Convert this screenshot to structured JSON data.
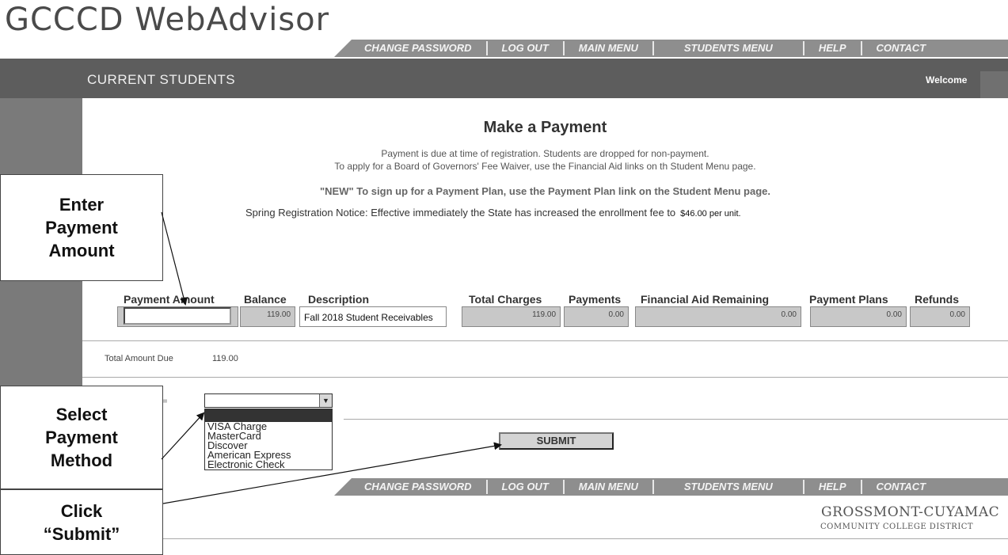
{
  "app": {
    "logo": "GCCCD WebAdvisor"
  },
  "nav": {
    "change_password": "CHANGE PASSWORD",
    "log_out": "LOG OUT",
    "main_menu": "MAIN MENU",
    "students_menu": "STUDENTS MENU",
    "help": "HELP",
    "contact": "CONTACT"
  },
  "header": {
    "section": "CURRENT STUDENTS",
    "welcome": "Welcome"
  },
  "page": {
    "title": "Make a Payment",
    "notice_line1": "Payment is due at time of registration. Students are dropped for non-payment.",
    "notice_line2": "To apply for a Board of Governors' Fee Waiver, use the Financial Aid links on th Student Menu page.",
    "notice_new": "\"NEW\" To sign up for a Payment Plan, use the Payment Plan link on the Student Menu page.",
    "notice_spring": "Spring Registration Notice: Effective immediately the State has increased the enrollment fee to",
    "notice_fee": "$46.00 per unit."
  },
  "table": {
    "headers": [
      "Payment Amount",
      "Balance",
      "Description",
      "Total Charges",
      "Payments",
      "Financial Aid Remaining",
      "Payment Plans",
      "Refunds"
    ],
    "row": {
      "payment_amount": "",
      "balance": "119.00",
      "description": "Fall 2018 Student Receivables",
      "total_charges": "119.00",
      "payments": "0.00",
      "financial_aid": "0.00",
      "payment_plans": "0.00",
      "refunds": "0.00"
    }
  },
  "totals": {
    "label": "Total Amount Due",
    "value": "119.00"
  },
  "payment_type": {
    "label": "Type=",
    "selected": "",
    "options": [
      "VISA Charge",
      "MasterCard",
      "Discover",
      "American Express",
      "Electronic Check"
    ]
  },
  "submit": {
    "label": "SUBMIT"
  },
  "footer": {
    "org": "GROSSMONT-CUYAMAC",
    "sub": "COMMUNITY COLLEGE DISTRICT"
  },
  "callouts": {
    "enter_amount": "Enter Payment Amount",
    "select_method": "Select Payment Method",
    "click_submit": "Click “Submit”"
  },
  "colors": {
    "header_bar": "#5d5d5d",
    "nav_bar": "#8e8e8e",
    "cell_gray": "#c8c8c8"
  }
}
